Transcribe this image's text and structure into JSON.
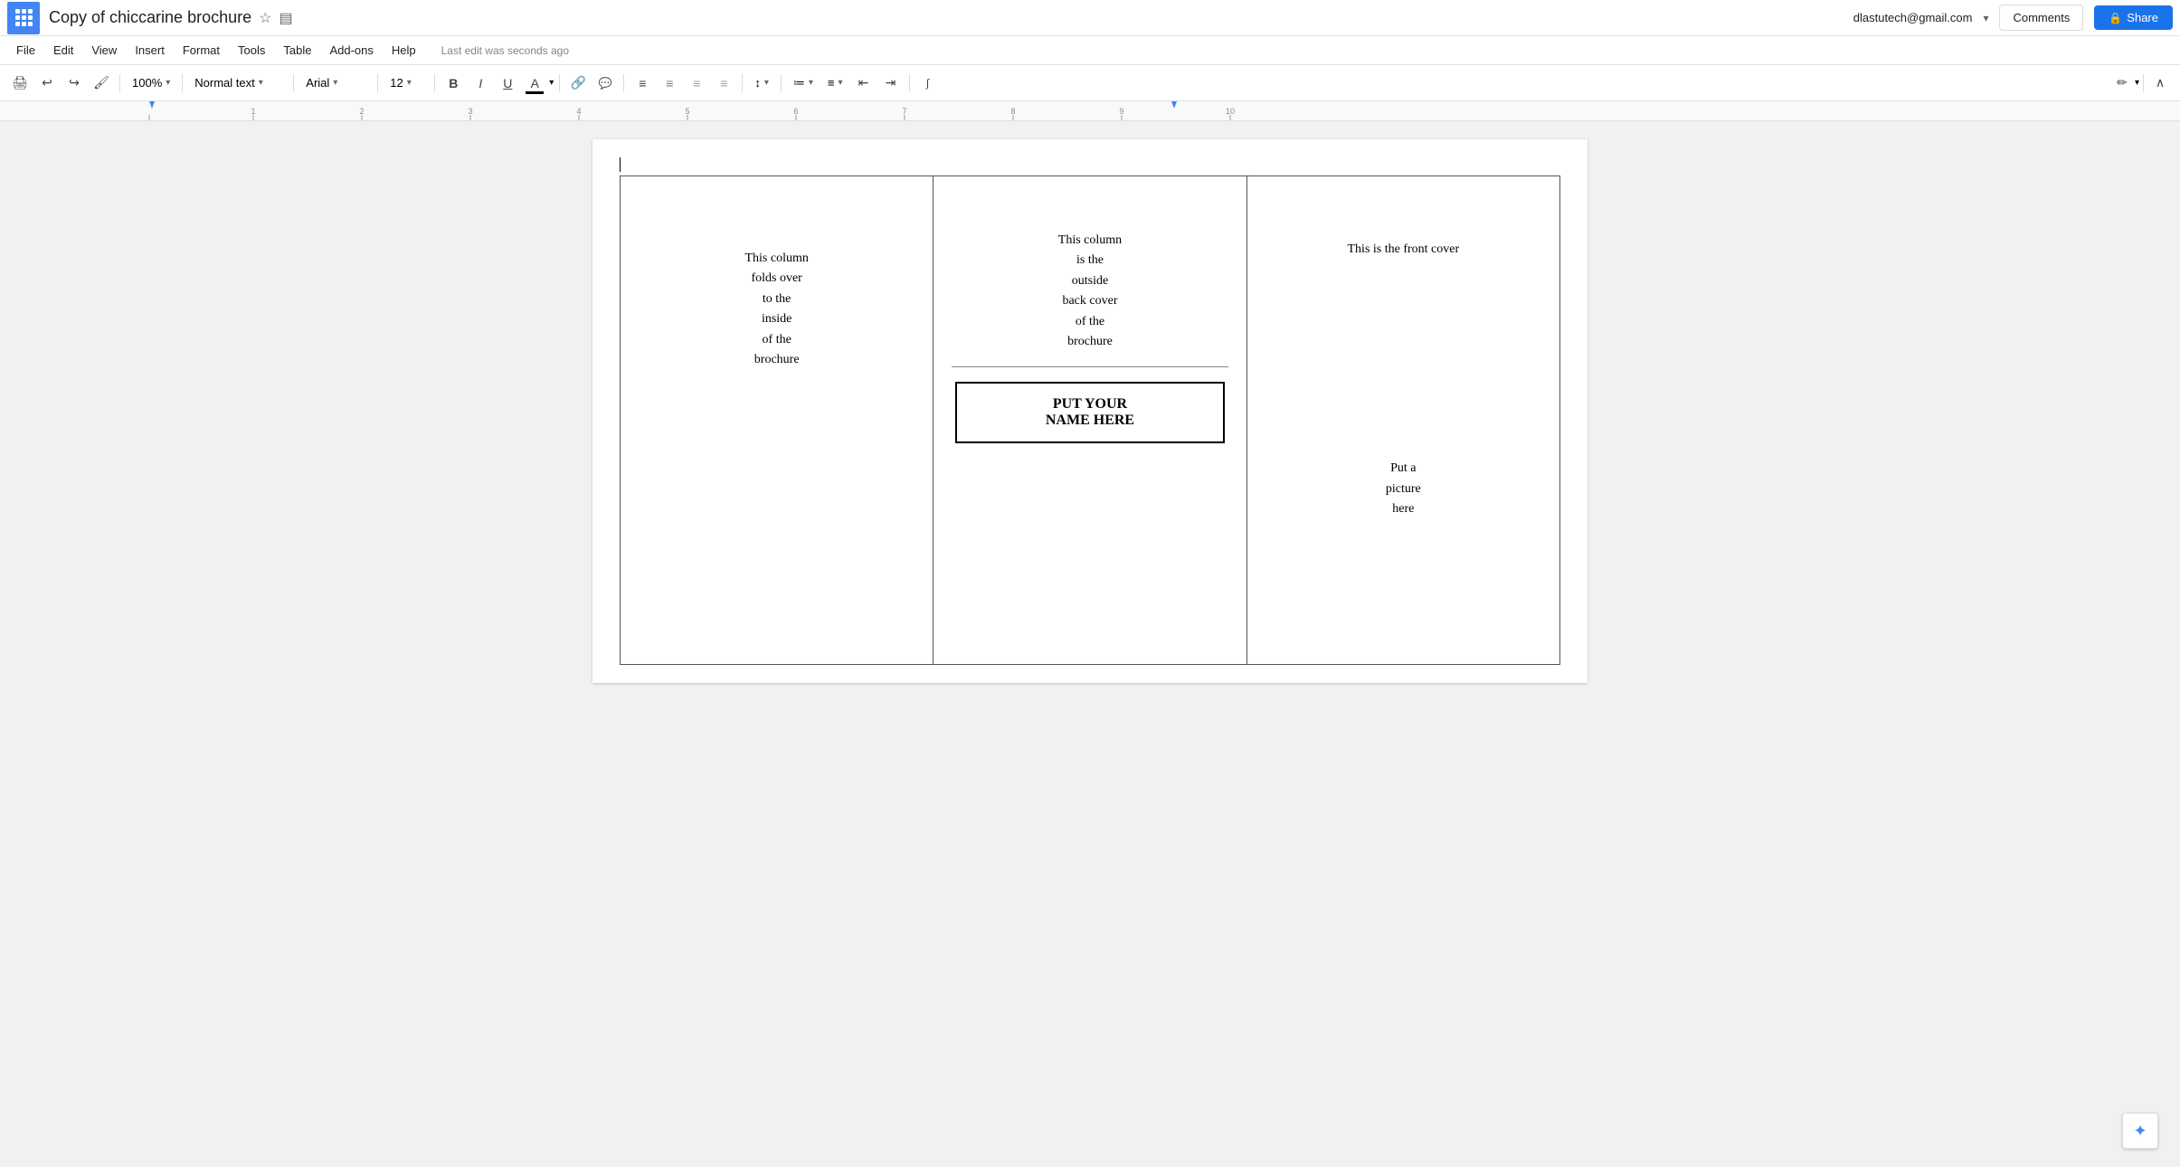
{
  "app": {
    "title": "Copy of chiccarine brochure",
    "user_email": "dlastutech@gmail.com",
    "last_edit": "Last edit was seconds ago",
    "star_icon": "★",
    "folder_icon": "📁"
  },
  "menu": {
    "items": [
      "File",
      "Edit",
      "View",
      "Insert",
      "Format",
      "Tools",
      "Table",
      "Add-ons",
      "Help"
    ]
  },
  "toolbar": {
    "zoom": "100%",
    "style": "Normal text",
    "font": "Arial",
    "size": "12",
    "bold_label": "B",
    "italic_label": "I",
    "underline_label": "U"
  },
  "buttons": {
    "comments": "Comments",
    "share": "Share"
  },
  "document": {
    "col1": {
      "text": "This column\nfolds over\nto the\ninside\nof the\nbrochure"
    },
    "col2": {
      "text": "This column\nis the\noutside\nback cover\nof the\nbrochure",
      "name_box": "PUT YOUR\nNAME HERE"
    },
    "col3": {
      "front_cover": "This is the front cover",
      "picture": "Put a\npicture\nhere"
    }
  }
}
